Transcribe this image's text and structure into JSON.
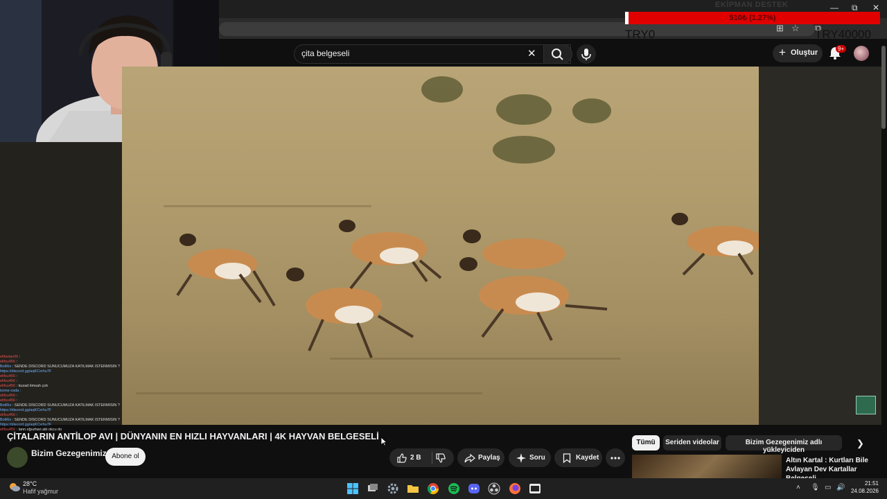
{
  "browser": {
    "minimize": "—",
    "restore": "⧉",
    "close": "✕"
  },
  "search": {
    "query": "çita belgeseli"
  },
  "header": {
    "create_label": "Oluştur",
    "notification_count": "9+"
  },
  "donation": {
    "title": "EKİPMAN DESTEK",
    "progress_text": "510₺ (1.27%)",
    "progress_fraction": 0.0127,
    "start_label": "TRY0",
    "goal_label": "TRY40000"
  },
  "chat": [
    {
      "user": "elifaslan06",
      "text": ":"
    },
    {
      "user": "elifsu456",
      "text": ":"
    },
    {
      "user": "BotRix",
      "text": ": SENDE DİSCORD SUNUCUMUZA KATILMAK İSTERMİSİN ?"
    },
    {
      "user": "",
      "text": "https://discord.gg/aqKCxrhu7F"
    },
    {
      "user": "elifsu456",
      "text": ":"
    },
    {
      "user": "elifsu456",
      "text": ":"
    },
    {
      "user": "elifsu456",
      "text": ": kuzad timsah çok"
    },
    {
      "user": "",
      "text": "tonne osda :"
    },
    {
      "user": "elifsu456",
      "text": ":"
    },
    {
      "user": "elifsu456",
      "text": ":"
    },
    {
      "user": "BotRix",
      "text": ": SENDE DİSCORD SUNUCUMUZA KATILMAK İSTERMİSİN ?"
    },
    {
      "user": "",
      "text": "https://discord.gg/aqKCxrhu7F"
    },
    {
      "user": "elifsu456",
      "text": ":"
    },
    {
      "user": "BotRix",
      "text": ": SENDE DİSCORD SUNUCUMUZA KATILMAK İSTERMİSİN ?"
    },
    {
      "user": "",
      "text": "https://discord.gg/aqKCxrhu7F"
    },
    {
      "user": "elifsu456",
      "text": ": lann oğuzhan abi okcu do"
    }
  ],
  "video": {
    "title": "ÇİTALARIN ANTİLOP AVI | DÜNYANIN EN HIZLI HAYVANLARI | 4K HAYVAN BELGESELİ",
    "channel": "Bizim Gezegenimiz",
    "subscribe_label": "Abone ol",
    "like_count": "2 B",
    "share_label": "Paylaş",
    "ask_label": "Soru",
    "save_label": "Kaydet"
  },
  "related": {
    "chips": [
      "Tümü",
      "Seriden videolar",
      "Bizim Gezegenimiz adlı yükleyiciden"
    ],
    "first_title": "Altın Kartal : Kurtları Bile Avlayan Dev Kartallar Belgeseli"
  },
  "taskbar": {
    "temperature": "28°C",
    "condition": "Hafif yağmur",
    "time": "21:51",
    "date": "24.08.2026"
  },
  "colors": {
    "bg": "#0f0f0f",
    "pill": "#272727",
    "donation_bar": "#e00000",
    "notification_badge": "#cc0000"
  }
}
